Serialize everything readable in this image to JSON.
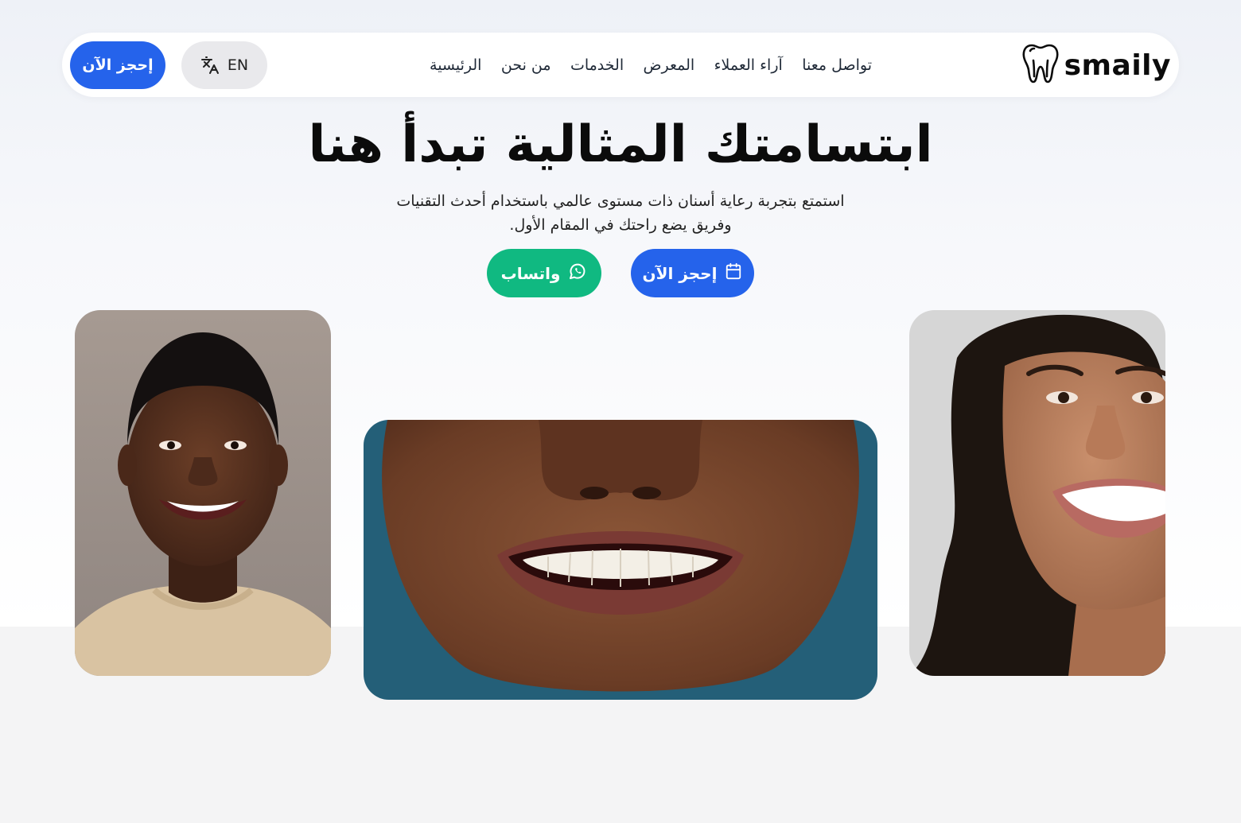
{
  "brand": {
    "name": "smaily",
    "logo_icon": "tooth-icon"
  },
  "nav": {
    "links": [
      "الرئيسية",
      "من نحن",
      "الخدمات",
      "المعرض",
      "آراء العملاء",
      "تواصل معنا"
    ],
    "language_label": "EN",
    "language_icon": "translate-icon",
    "book_label": "إحجز الآن"
  },
  "hero": {
    "title": "ابتسامتك المثالية تبدأ هنا",
    "subtitle_line1": "استمتع بتجربة رعاية أسنان ذات مستوى عالمي باستخدام أحدث التقنيات",
    "subtitle_line2": "وفريق يضع راحتك في المقام الأول.",
    "book_button": "إحجز الآن",
    "book_icon": "calendar-icon",
    "whatsapp_button": "واتساب",
    "whatsapp_icon": "whatsapp-icon"
  },
  "colors": {
    "primary": "#2563eb",
    "whatsapp": "#10b981",
    "text": "#0b0b0b"
  }
}
